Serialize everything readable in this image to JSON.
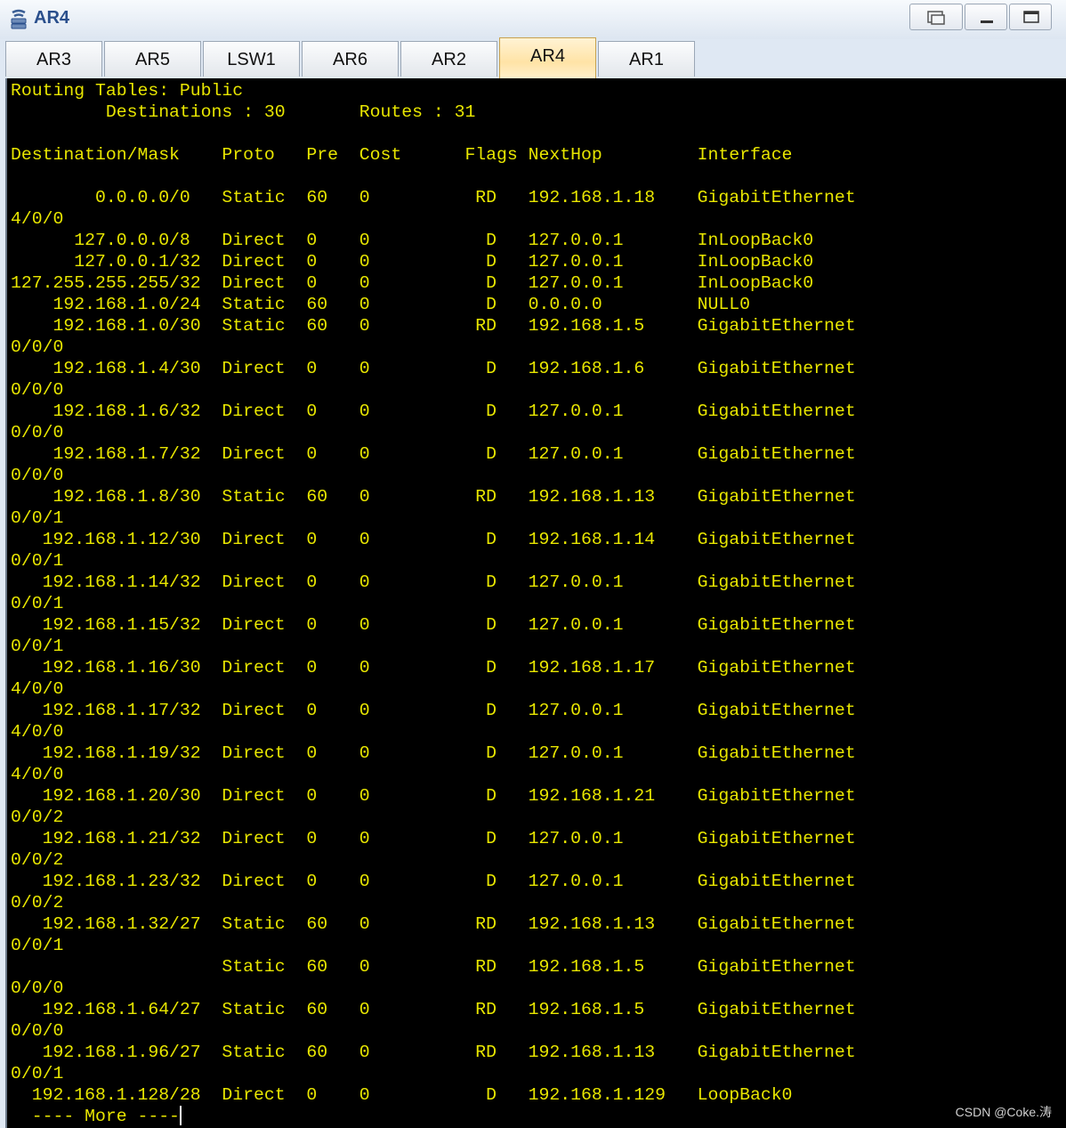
{
  "window": {
    "title": "AR4",
    "icon": "router-icon"
  },
  "tabs": [
    {
      "label": "AR3",
      "active": false
    },
    {
      "label": "AR5",
      "active": false
    },
    {
      "label": "LSW1",
      "active": false
    },
    {
      "label": "AR6",
      "active": false
    },
    {
      "label": "AR2",
      "active": false
    },
    {
      "label": "AR4",
      "active": true
    },
    {
      "label": "AR1",
      "active": false
    }
  ],
  "terminal": {
    "text_color": "#e8e600",
    "background": "#000000",
    "lines": [
      "Routing Tables: Public",
      "         Destinations : 30       Routes : 31",
      "",
      "Destination/Mask    Proto   Pre  Cost      Flags NextHop         Interface",
      "",
      "        0.0.0.0/0   Static  60   0          RD   192.168.1.18    GigabitEthernet",
      "4/0/0",
      "      127.0.0.0/8   Direct  0    0           D   127.0.0.1       InLoopBack0",
      "      127.0.0.1/32  Direct  0    0           D   127.0.0.1       InLoopBack0",
      "127.255.255.255/32  Direct  0    0           D   127.0.0.1       InLoopBack0",
      "    192.168.1.0/24  Static  60   0           D   0.0.0.0         NULL0",
      "    192.168.1.0/30  Static  60   0          RD   192.168.1.5     GigabitEthernet",
      "0/0/0",
      "    192.168.1.4/30  Direct  0    0           D   192.168.1.6     GigabitEthernet",
      "0/0/0",
      "    192.168.1.6/32  Direct  0    0           D   127.0.0.1       GigabitEthernet",
      "0/0/0",
      "    192.168.1.7/32  Direct  0    0           D   127.0.0.1       GigabitEthernet",
      "0/0/0",
      "    192.168.1.8/30  Static  60   0          RD   192.168.1.13    GigabitEthernet",
      "0/0/1",
      "   192.168.1.12/30  Direct  0    0           D   192.168.1.14    GigabitEthernet",
      "0/0/1",
      "   192.168.1.14/32  Direct  0    0           D   127.0.0.1       GigabitEthernet",
      "0/0/1",
      "   192.168.1.15/32  Direct  0    0           D   127.0.0.1       GigabitEthernet",
      "0/0/1",
      "   192.168.1.16/30  Direct  0    0           D   192.168.1.17    GigabitEthernet",
      "4/0/0",
      "   192.168.1.17/32  Direct  0    0           D   127.0.0.1       GigabitEthernet",
      "4/0/0",
      "   192.168.1.19/32  Direct  0    0           D   127.0.0.1       GigabitEthernet",
      "4/0/0",
      "   192.168.1.20/30  Direct  0    0           D   192.168.1.21    GigabitEthernet",
      "0/0/2",
      "   192.168.1.21/32  Direct  0    0           D   127.0.0.1       GigabitEthernet",
      "0/0/2",
      "   192.168.1.23/32  Direct  0    0           D   127.0.0.1       GigabitEthernet",
      "0/0/2",
      "   192.168.1.32/27  Static  60   0          RD   192.168.1.13    GigabitEthernet",
      "0/0/1",
      "                    Static  60   0          RD   192.168.1.5     GigabitEthernet",
      "0/0/0",
      "   192.168.1.64/27  Static  60   0          RD   192.168.1.5     GigabitEthernet",
      "0/0/0",
      "   192.168.1.96/27  Static  60   0          RD   192.168.1.13    GigabitEthernet",
      "0/0/1",
      "  192.168.1.128/28  Direct  0    0           D   192.168.1.129   LoopBack0"
    ],
    "more_prompt": "  ---- More ----"
  },
  "watermark": "CSDN @Coke.涛"
}
